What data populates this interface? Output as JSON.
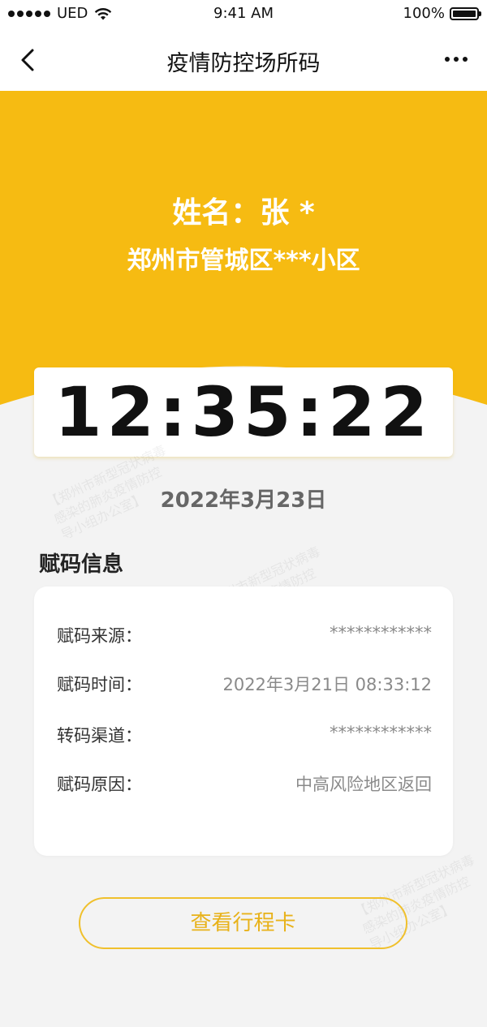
{
  "status_bar": {
    "carrier": "UED",
    "time": "9:41 AM",
    "battery": "100%",
    "icons": {
      "signal": "signal-icon",
      "wifi": "wifi-icon",
      "battery": "battery-icon"
    }
  },
  "nav": {
    "title": "疫情防控场所码",
    "back_icon": "chevron-left-icon",
    "more_icon": "more-dots-icon"
  },
  "person": {
    "name": "姓名：张 *",
    "address": "郑州市管城区***小区"
  },
  "clock": {
    "time": "12:35:22",
    "date": "2022年3月23日"
  },
  "section": {
    "title": "赋码信息"
  },
  "info": [
    {
      "label": "赋码来源：",
      "value": "************"
    },
    {
      "label": "赋码时间：",
      "value": "2022年3月21日 08:33:12"
    },
    {
      "label": "转码渠道：",
      "value": "************"
    },
    {
      "label": "赋码原因：",
      "value": "中高风险地区返回"
    }
  ],
  "button": {
    "label": "查看行程卡"
  },
  "watermark": {
    "text": "【郑州市新型冠状病毒\n感染的肺炎疫情防控\n导小组办公室】"
  },
  "colors": {
    "header_yellow": "#f6bb12",
    "background": "#f3f3f3",
    "button_border": "#f0c02c",
    "button_text": "#e8b21a"
  }
}
